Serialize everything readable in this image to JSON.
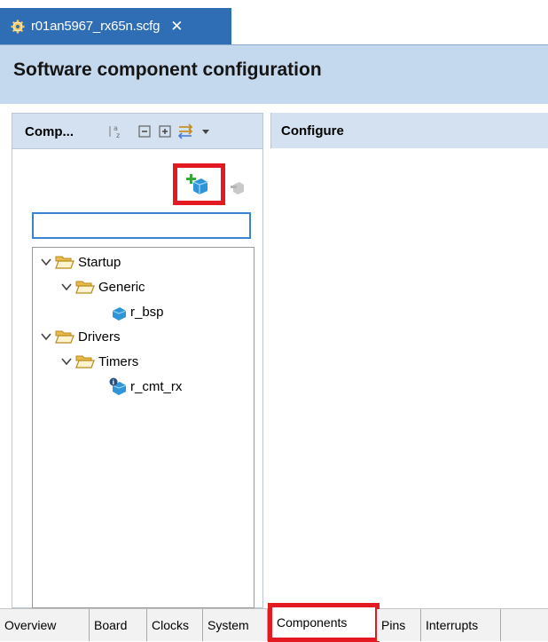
{
  "editor_tab": {
    "title": "r01an5967_rx65n.scfg",
    "close_glyph": "✕",
    "icon": "gear-icon"
  },
  "header": {
    "title": "Software component configuration"
  },
  "components_panel": {
    "label": "Comp...",
    "toolbar_icons": [
      "sort-alpha-icon",
      "collapse-all-icon",
      "expand-all-icon",
      "filter-arrows-icon",
      "view-menu-dropdown-icon"
    ],
    "add_icon": "add-component-icon",
    "remove_icon": "remove-component-icon",
    "filter": {
      "value": "",
      "placeholder": ""
    },
    "tree": [
      {
        "label": "Startup",
        "level": 0,
        "type": "folder",
        "expanded": true
      },
      {
        "label": "Generic",
        "level": 1,
        "type": "folder",
        "expanded": true
      },
      {
        "label": "r_bsp",
        "level": 2,
        "type": "component"
      },
      {
        "label": "Drivers",
        "level": 0,
        "type": "folder",
        "expanded": true
      },
      {
        "label": "Timers",
        "level": 1,
        "type": "folder",
        "expanded": true
      },
      {
        "label": "r_cmt_rx",
        "level": 2,
        "type": "component-info"
      }
    ]
  },
  "configure_panel": {
    "label": "Configure"
  },
  "bottom_tabs": [
    {
      "label": "Overview",
      "active": false
    },
    {
      "label": "Board",
      "active": false
    },
    {
      "label": "Clocks",
      "active": false
    },
    {
      "label": "System",
      "active": false
    },
    {
      "label": "Components",
      "active": true
    },
    {
      "label": "Pins",
      "active": false
    },
    {
      "label": "Interrupts",
      "active": false
    }
  ],
  "colors": {
    "tab_active": "#2f6db5",
    "header_bg": "#c4d8ee",
    "panel_head_bg": "#d3e1f0",
    "highlight": "#e41a22",
    "focus_border": "#3b82d0"
  }
}
